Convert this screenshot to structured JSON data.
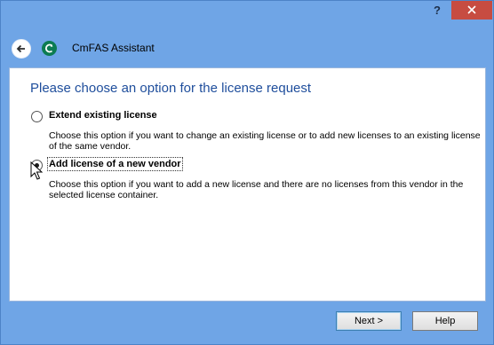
{
  "titlebar": {
    "help_label": "?",
    "close_icon": "close-icon"
  },
  "header": {
    "app_title": "CmFAS Assistant",
    "back_icon": "back-arrow-icon",
    "app_icon": "codemeter-icon"
  },
  "main": {
    "heading": "Please choose an option for the license request",
    "options": [
      {
        "label": "Extend existing license",
        "description": "Choose this option if you want to change an existing license or to add new licenses to an existing license of the same vendor.",
        "selected": false
      },
      {
        "label": "Add license of a new vendor",
        "description": "Choose this option if you want to add a new license and there are no licenses from this vendor in the selected license container.",
        "selected": true
      }
    ]
  },
  "footer": {
    "next_label": "Next >",
    "help_label": "Help"
  },
  "colors": {
    "frame": "#6fa5e6",
    "heading": "#1f4e9c",
    "close": "#c74c41"
  }
}
